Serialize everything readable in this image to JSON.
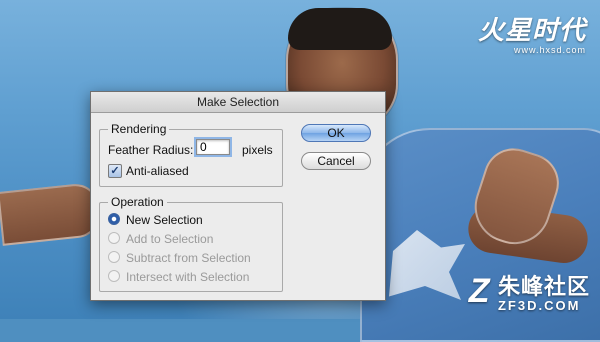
{
  "background": {
    "watermark_top": {
      "mark": "火星时代",
      "url": "www.hxsd.com"
    },
    "watermark_bottom": {
      "mark": "Z",
      "cn": "朱峰社区",
      "en": "ZF3D.COM"
    }
  },
  "dialog": {
    "title": "Make Selection",
    "rendering": {
      "label": "Rendering",
      "feather_label": "Feather Radius:",
      "feather_value": "0",
      "feather_unit": "pixels",
      "antialiased_label": "Anti-aliased",
      "antialiased_checked": true
    },
    "operation": {
      "label": "Operation",
      "options": [
        {
          "label": "New Selection",
          "selected": true,
          "enabled": true
        },
        {
          "label": "Add to Selection",
          "selected": false,
          "enabled": false
        },
        {
          "label": "Subtract from Selection",
          "selected": false,
          "enabled": false
        },
        {
          "label": "Intersect with Selection",
          "selected": false,
          "enabled": false
        }
      ]
    },
    "buttons": {
      "ok": "OK",
      "cancel": "Cancel"
    }
  },
  "colors": {
    "sky": "#5f9fd1",
    "dialog_bg": "#ececec",
    "default_button": "#6fa3e2",
    "selected_radio": "#2f5ea8"
  }
}
